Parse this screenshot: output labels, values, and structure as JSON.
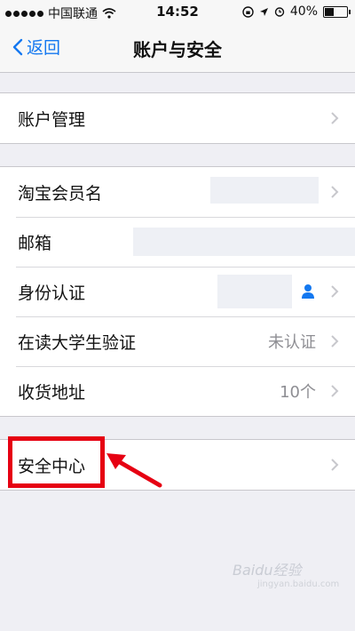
{
  "status_bar": {
    "carrier": "中国联通",
    "time": "14:52",
    "battery": "40%",
    "battery_level": 0.4
  },
  "nav": {
    "back_label": "返回",
    "title": "账户与安全"
  },
  "groups": [
    {
      "rows": [
        {
          "label": "账户管理",
          "value": ""
        }
      ]
    },
    {
      "rows": [
        {
          "label": "淘宝会员名",
          "value": ""
        },
        {
          "label": "邮箱",
          "value": ""
        },
        {
          "label": "身份认证",
          "value": ""
        },
        {
          "label": "在读大学生验证",
          "value": "未认证"
        },
        {
          "label": "收货地址",
          "value": "10个"
        }
      ]
    },
    {
      "rows": [
        {
          "label": "安全中心",
          "value": ""
        }
      ]
    }
  ],
  "colors": {
    "accent": "#1478f0",
    "highlight": "#e60012",
    "background": "#efeff4"
  },
  "watermark": {
    "text": "Baidu经验",
    "sub": "jingyan.baidu.com"
  }
}
